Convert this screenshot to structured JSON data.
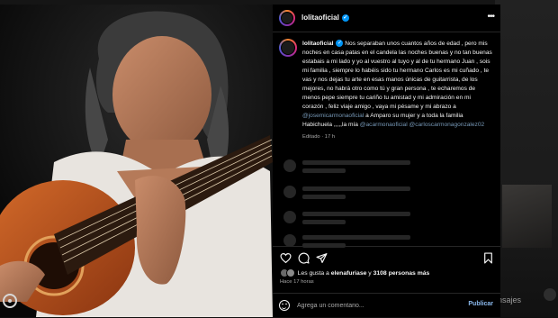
{
  "background": {
    "right_text": "ensajes"
  },
  "post": {
    "username": "lolitaoficial",
    "caption_user": "lolitaoficial",
    "caption_text": "Nos separaban unos cuantos años de edad , pero mis noches en casa patas en el candela las noches buenas y no tan buenas estabais a mi lado y yo al vuestro al tuyo y al de tu hermano Juan , sois mi familia , siempre lo habéis sido tu hermano Carlos es mi cuñado , te vas y nos dejas tu arte en esas manos únicas de guitarrista, de los mejores, no habrá otro como tú y gran persona , te echaremos de menos pepe siempre tu cariño tu amistad y mi admiración en mi corazón , feliz viaje amigo , vaya mi pésame y mi abrazo a",
    "mention_1": "@josemicarmonaoficial",
    "caption_text_2": "a Amparo su mujer y a toda la familia Habichuela ,,,,,la mía",
    "mention_2": "@acarmonaoficial",
    "mention_3": "@carloscarmonagonzalez02",
    "edited_label": "Editado · 17 h",
    "likes_prefix": "Les gusta a",
    "likes_user": "elenafuriase",
    "likes_middle": "y",
    "likes_count": "3108 personas más",
    "time_ago": "Hace 17 horas",
    "comment_placeholder": "Agrega un comentario...",
    "publish_label": "Publicar"
  },
  "icons": {
    "more": "more-icon",
    "heart": "heart-icon",
    "comment": "comment-icon",
    "share": "share-icon",
    "save": "bookmark-icon",
    "emoji": "emoji-icon",
    "verified": "verified-badge-icon"
  },
  "colors": {
    "panel_bg": "#000000",
    "text": "#f5f5f5",
    "secondary": "#a8a8a8",
    "mention": "#9bc7ef",
    "verified": "#0095f6"
  }
}
